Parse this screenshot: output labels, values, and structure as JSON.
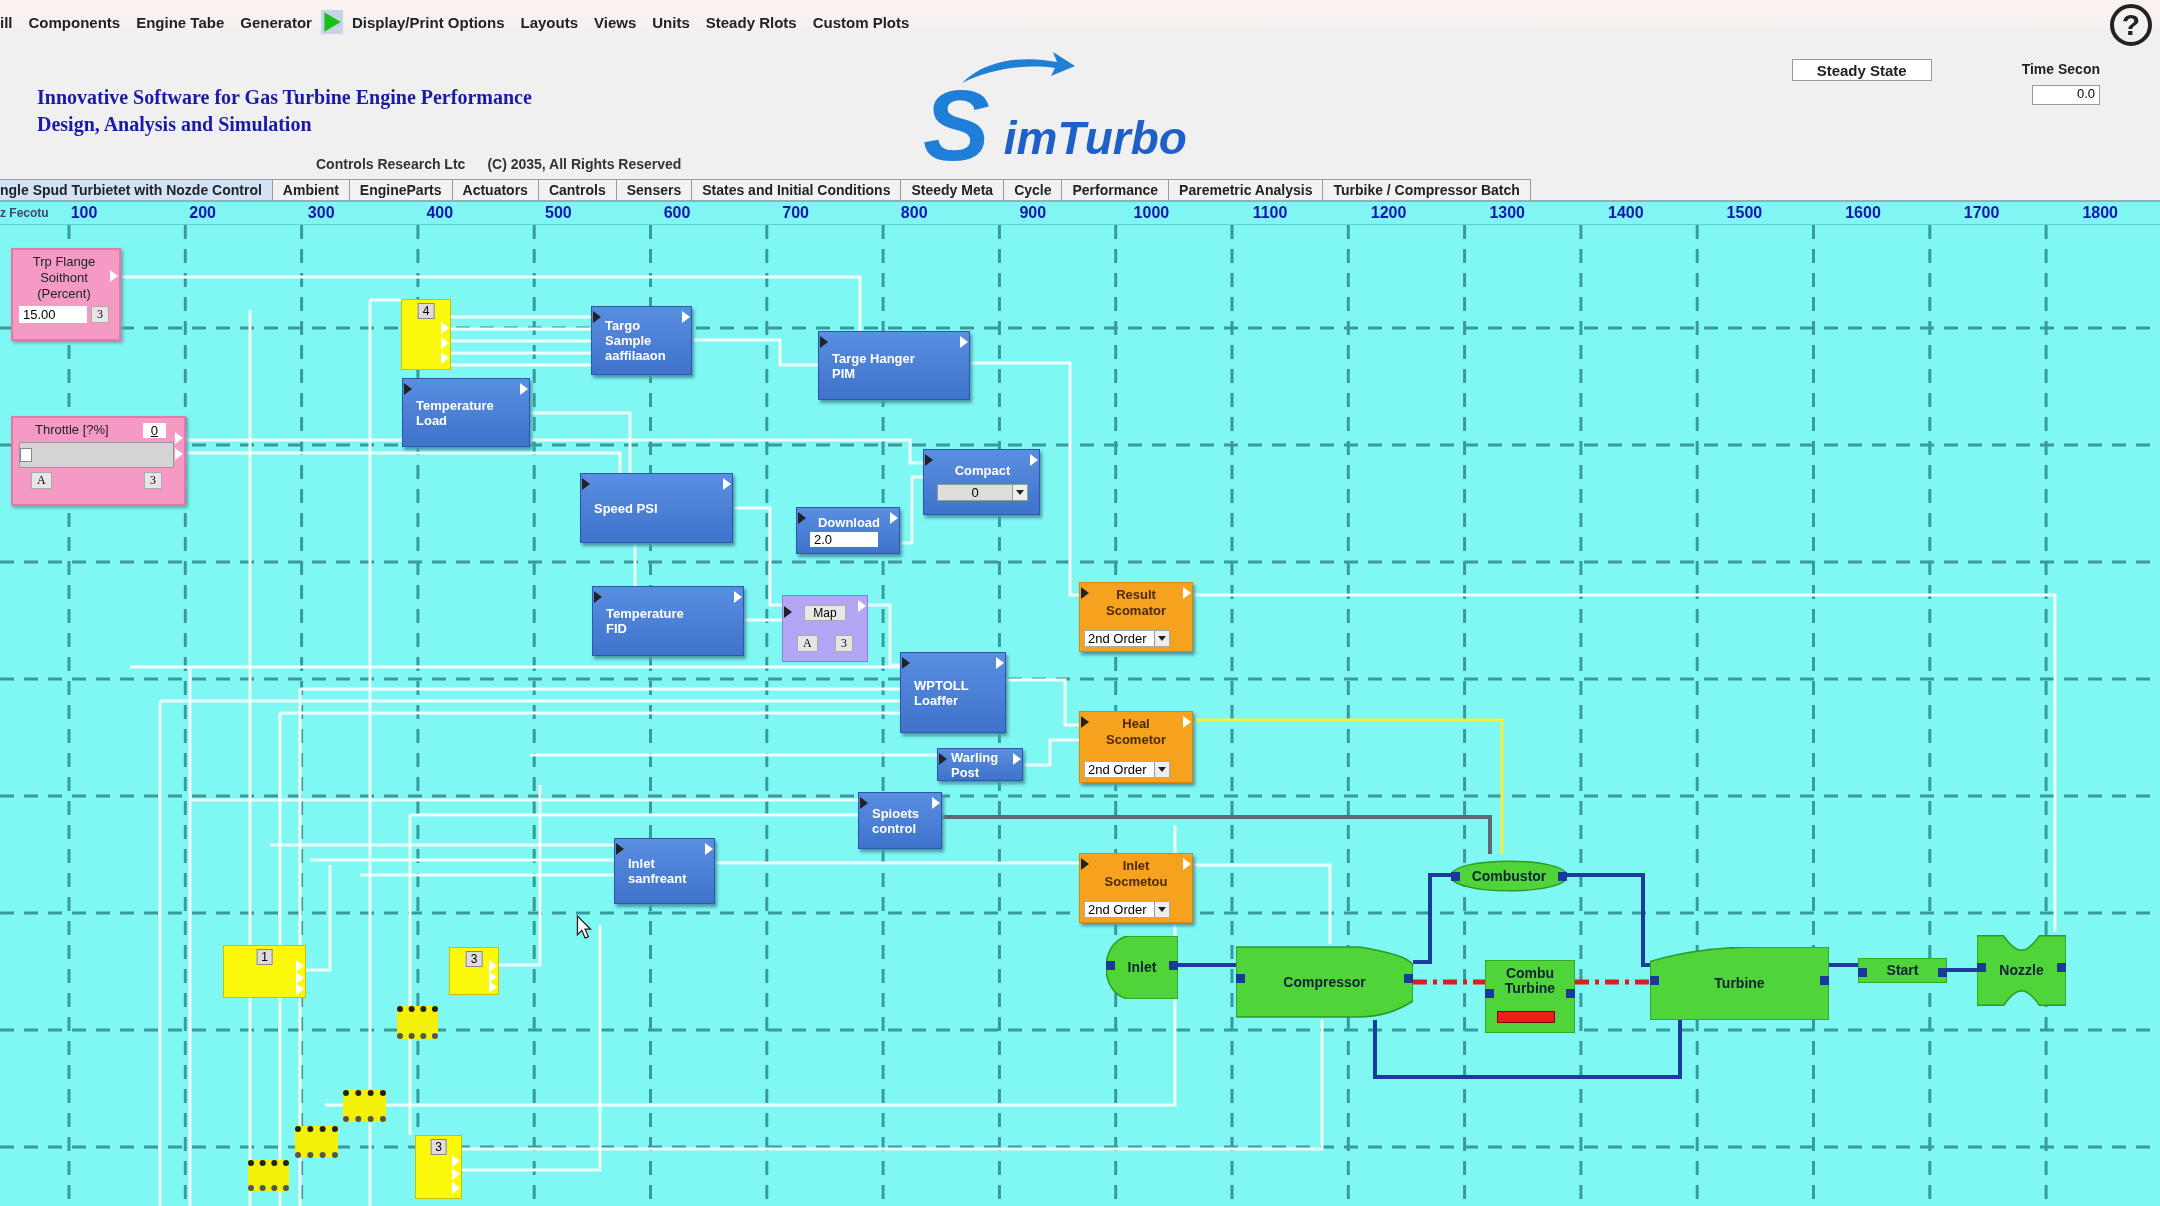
{
  "menu": [
    {
      "label": "ill"
    },
    {
      "label": "Components"
    },
    {
      "label": "Engine Tabe"
    },
    {
      "label": "Generator"
    },
    {
      "label": "Display/Print Options"
    },
    {
      "label": "Layouts"
    },
    {
      "label": "Views"
    },
    {
      "label": "Units"
    },
    {
      "label": "Steady Rlots"
    },
    {
      "label": "Custom Plots"
    }
  ],
  "help": "?",
  "header": {
    "title_lines": [
      "Innovative Software for Gas Turbine Engine Performance",
      "Design, Analysis and Simulation"
    ],
    "company": "Controls Research Ltc",
    "copyright": "(C) 2035,  All Rights Reserved",
    "logo_initial": "S",
    "logo_rest": "imTurbo"
  },
  "mode_button": "Steady State",
  "time": {
    "label": "Time Secon",
    "value": "0.0"
  },
  "tabs": [
    {
      "label": "ngle Spud Turbietet with Nozde Control",
      "selected": true
    },
    {
      "label": "Ambient",
      "selected": false
    },
    {
      "label": "EngineParts",
      "selected": false
    },
    {
      "label": "Actuators",
      "selected": false
    },
    {
      "label": "Cantrols",
      "selected": false
    },
    {
      "label": "Sensers",
      "selected": false
    },
    {
      "label": "States and Initial Conditions",
      "selected": false
    },
    {
      "label": "Steedy Meta",
      "selected": false
    },
    {
      "label": "Cycle",
      "selected": false
    },
    {
      "label": "Performance",
      "selected": false
    },
    {
      "label": "Paremetric Analysis",
      "selected": false
    },
    {
      "label": "Turbike / Compressor Batch",
      "selected": false
    }
  ],
  "ruler": {
    "label": "z Fecotu",
    "ticks": [
      "100",
      "200",
      "300",
      "400",
      "500",
      "600",
      "700",
      "800",
      "900",
      "1000",
      "1100",
      "1200",
      "1300",
      "1400",
      "1500",
      "1600",
      "1700",
      "1800"
    ]
  },
  "controls": [
    {
      "kind": "param",
      "label": "Trp Flange\nSoithont\n(Percent)",
      "value": "15.00",
      "button": "3"
    },
    {
      "kind": "mux",
      "number": "4"
    },
    {
      "kind": "block",
      "label": "Targo\nSample\naaffilaaon"
    },
    {
      "kind": "block",
      "label": "Targe Hanger\nPIM"
    },
    {
      "kind": "block",
      "label": "Temperature\nLoad"
    },
    {
      "kind": "throttle",
      "label": "Throttle [?%]",
      "value": "0",
      "level": 0,
      "buttons": [
        "A",
        "3"
      ]
    },
    {
      "kind": "block",
      "label": "Speed PSI"
    },
    {
      "kind": "select_block",
      "label": "Compact",
      "value": "0"
    },
    {
      "kind": "field_block",
      "label": "Download",
      "value": "2.0"
    },
    {
      "kind": "block",
      "label": "Temperature\nFID"
    },
    {
      "kind": "map",
      "label": "Map",
      "buttons": [
        "A",
        "3"
      ]
    },
    {
      "kind": "filter",
      "label": "Result\nScomator",
      "value": "2nd Order"
    },
    {
      "kind": "block",
      "label": "WPTOLL\nLoaffer"
    },
    {
      "kind": "block",
      "label": "Warling\nPost"
    },
    {
      "kind": "filter",
      "label": "Heal\nScometor",
      "value": "2nd Order"
    },
    {
      "kind": "block",
      "label": "Spioets\ncontrol"
    },
    {
      "kind": "block",
      "label": "Inlet\nsanfreant"
    },
    {
      "kind": "filter",
      "label": "Inlet\nSocmetou",
      "value": "2nd Order"
    }
  ],
  "engine": [
    {
      "kind": "combustor",
      "label": "Combustor"
    },
    {
      "kind": "inlet",
      "label": "Inlet"
    },
    {
      "kind": "compressor",
      "label": "Compressor"
    },
    {
      "kind": "shaft",
      "label": "Combu\nTurbine"
    },
    {
      "kind": "turbine",
      "label": "Turbine"
    },
    {
      "kind": "duct",
      "label": "Start"
    },
    {
      "kind": "nozzle",
      "label": "Nozzle"
    }
  ],
  "connectors": [
    {
      "kind": "mux",
      "number": "1"
    },
    {
      "kind": "mux",
      "number": "3"
    },
    {
      "kind": "junction"
    },
    {
      "kind": "junction"
    },
    {
      "kind": "junction"
    },
    {
      "kind": "junction"
    },
    {
      "kind": "mux",
      "number": "3"
    }
  ]
}
